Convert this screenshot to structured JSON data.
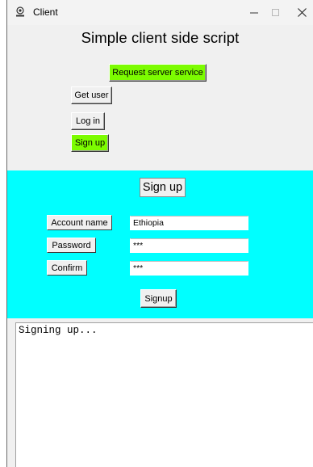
{
  "window": {
    "title": "Client",
    "controls": {
      "minimize_icon": "minimize-icon",
      "maximize_icon": "maximize-icon",
      "close_icon": "close-icon"
    }
  },
  "header": {
    "title": "Simple client side script"
  },
  "actions": {
    "request_service": "Request server service",
    "get_user": "Get user",
    "log_in": "Log in",
    "sign_up": "Sign up"
  },
  "signup_form": {
    "heading": "Sign up",
    "account_name_label": "Account name",
    "account_name_value": "Ethiopia",
    "password_label": "Password",
    "password_value": "***",
    "confirm_label": "Confirm",
    "confirm_value": "***",
    "submit_label": "Signup"
  },
  "output": {
    "text": "Signing up..."
  },
  "colors": {
    "green_button": "#7cfc00",
    "form_background": "#00ffff",
    "window_background": "#f0f0f0"
  }
}
